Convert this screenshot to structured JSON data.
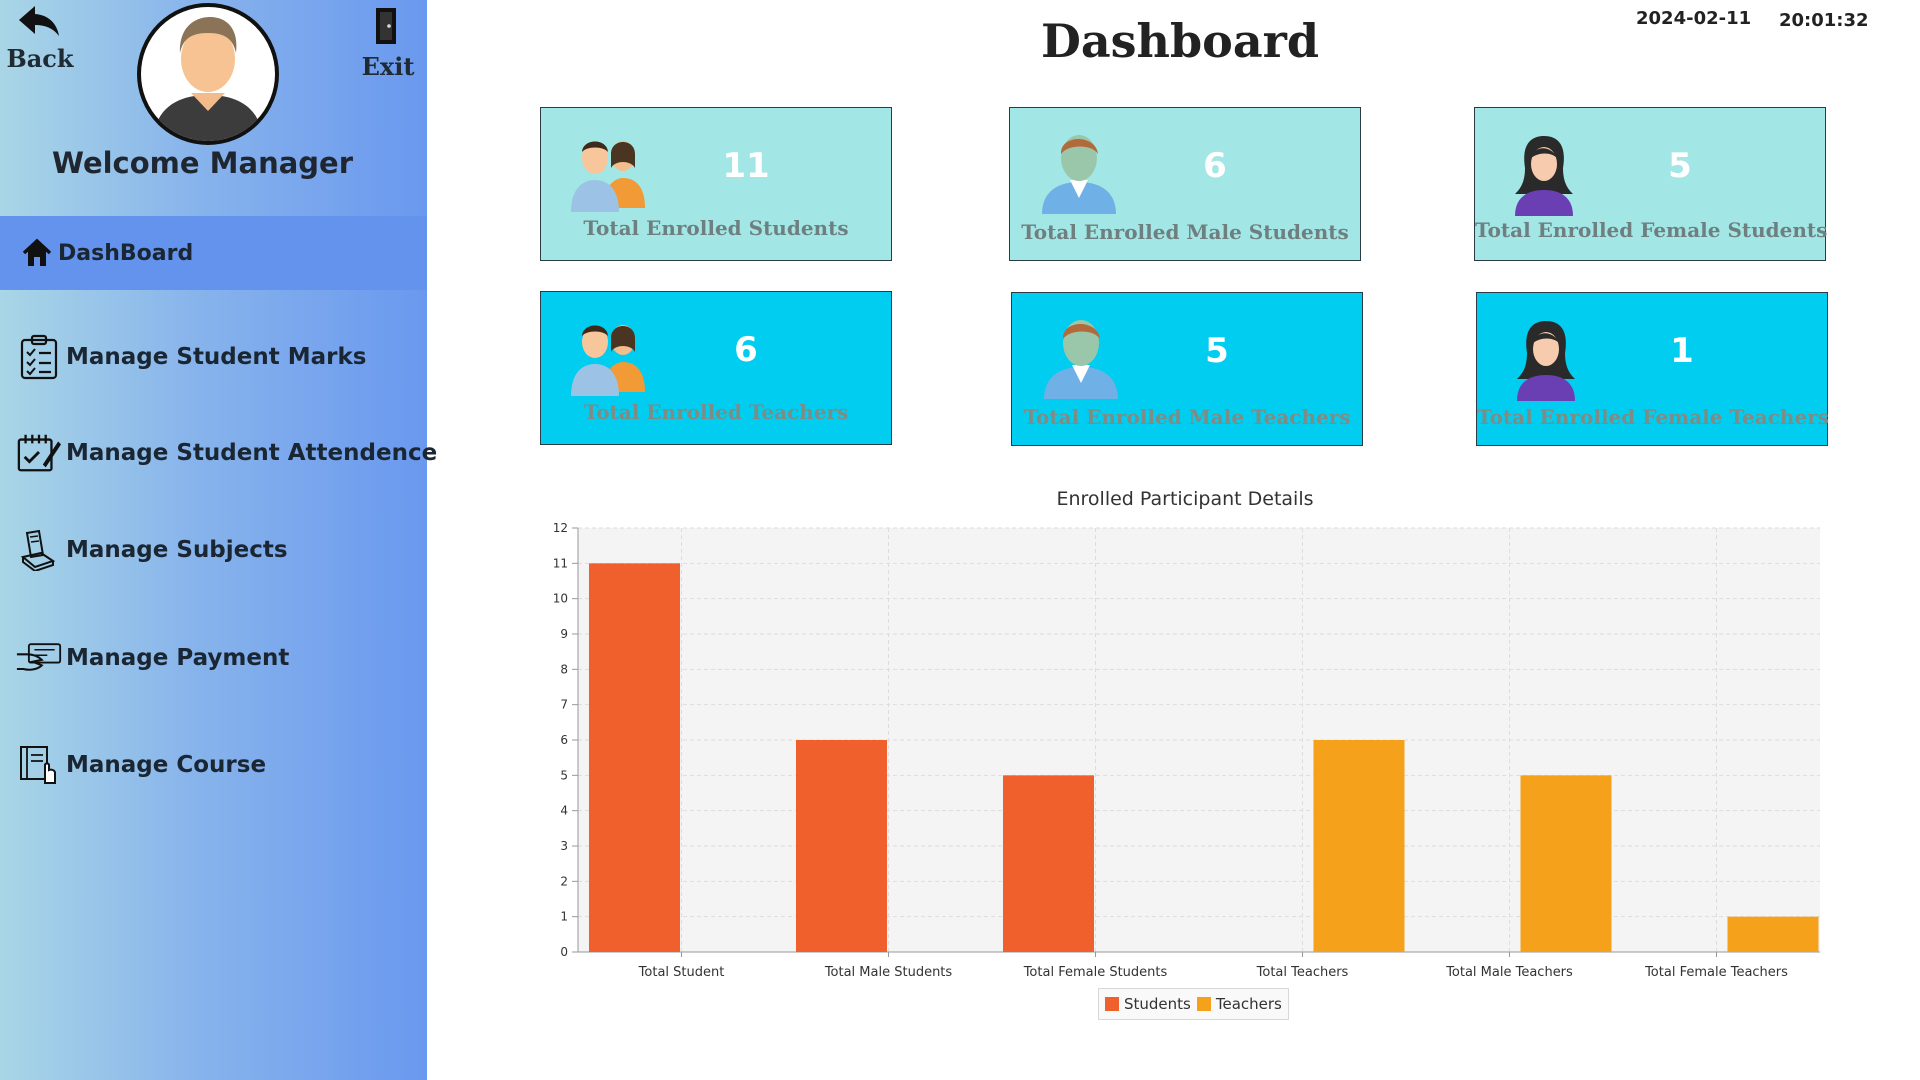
{
  "sidebar": {
    "back_label": "Back",
    "exit_label": "Exit",
    "welcome": "Welcome Manager",
    "items": [
      {
        "label": "DashBoard",
        "icon": "home-icon",
        "active": true
      },
      {
        "label": "Manage Student Marks",
        "icon": "clipboard-checklist-icon"
      },
      {
        "label": "Manage Student Attendence",
        "icon": "attendance-pad-icon"
      },
      {
        "label": "Manage Subjects",
        "icon": "books-icon"
      },
      {
        "label": "Manage Payment",
        "icon": "payment-hand-icon"
      },
      {
        "label": "Manage Course",
        "icon": "course-book-icon"
      }
    ]
  },
  "header": {
    "title": "Dashboard",
    "date": "2024-02-11",
    "time": "20:01:32"
  },
  "cards": [
    {
      "value": "11",
      "label": "Total Enrolled Students",
      "icon": "group-icon"
    },
    {
      "value": "6",
      "label": "Total Enrolled Male Students",
      "icon": "male-user-icon"
    },
    {
      "value": "5",
      "label": "Total Enrolled Female Students",
      "icon": "female-user-icon"
    },
    {
      "value": "6",
      "label": "Total Enrolled Teachers",
      "icon": "group-icon"
    },
    {
      "value": "5",
      "label": "Total Enrolled Male Teachers",
      "icon": "male-user-icon"
    },
    {
      "value": "1",
      "label": "Total Enrolled Female Teachers",
      "icon": "female-user-icon"
    }
  ],
  "colors": {
    "sidebar_active": "#6393ec",
    "card_light": "#a2e7e6",
    "card_cyan": "#00cdef",
    "students": "#f0602c",
    "teachers": "#f5a11c"
  },
  "chart_data": {
    "type": "bar",
    "title": "Enrolled Participant Details",
    "xlabel": "",
    "ylabel": "",
    "ylim": [
      0,
      12
    ],
    "yticks": [
      0,
      1,
      2,
      3,
      4,
      5,
      6,
      7,
      8,
      9,
      10,
      11,
      12
    ],
    "categories": [
      "Total Student",
      "Total Male Students",
      "Total Female Students",
      "Total Teachers",
      "Total Male Teachers",
      "Total Female Teachers"
    ],
    "series": [
      {
        "name": "Students",
        "color": "#f0602c",
        "values": [
          11,
          6,
          5,
          null,
          null,
          null
        ]
      },
      {
        "name": "Teachers",
        "color": "#f5a11c",
        "values": [
          null,
          null,
          null,
          6,
          5,
          1
        ]
      }
    ],
    "grid": true,
    "legend": "bottom"
  }
}
